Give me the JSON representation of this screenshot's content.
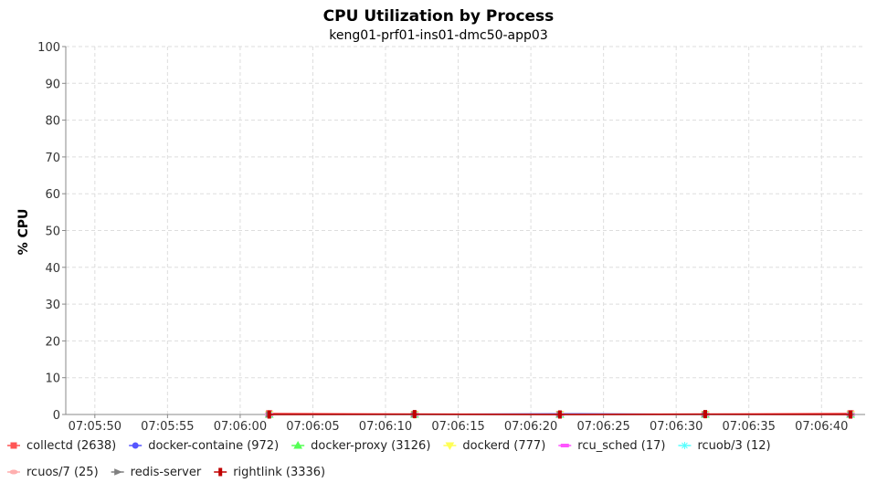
{
  "chart_data": {
    "type": "line",
    "title": "CPU Utilization by Process",
    "subtitle": "keng01-prf01-ins01-dmc50-app03",
    "xlabel": "",
    "ylabel": "% CPU",
    "ylim": [
      0,
      100
    ],
    "y_ticks": [
      0,
      10,
      20,
      30,
      40,
      50,
      60,
      70,
      80,
      90,
      100
    ],
    "x_range": [
      "07:05:48",
      "07:06:43"
    ],
    "x_ticks": [
      "07:05:50",
      "07:05:55",
      "07:06:00",
      "07:06:05",
      "07:06:10",
      "07:06:15",
      "07:06:20",
      "07:06:25",
      "07:06:30",
      "07:06:35",
      "07:06:40"
    ],
    "grid": true,
    "legend_position": "bottom",
    "x": [
      "07:06:02",
      "07:06:12",
      "07:06:22",
      "07:06:32",
      "07:06:42"
    ],
    "series": [
      {
        "name": "collectd (2638)",
        "color": "#ff5555",
        "marker": "square",
        "values": [
          0.3,
          0.1,
          0.1,
          0.1,
          0.3
        ]
      },
      {
        "name": "docker-containe (972)",
        "color": "#5555ff",
        "marker": "circle",
        "values": [
          0.0,
          0.0,
          0.2,
          0.0,
          0.0
        ]
      },
      {
        "name": "docker-proxy (3126)",
        "color": "#55ff55",
        "marker": "triangle-up",
        "values": [
          0,
          0,
          0,
          0,
          0
        ]
      },
      {
        "name": "dockerd (777)",
        "color": "#ffff55",
        "marker": "triangle-down",
        "values": [
          0,
          0,
          0,
          0,
          0
        ]
      },
      {
        "name": "rcu_sched (17)",
        "color": "#ff55ff",
        "marker": "hbar",
        "values": [
          0,
          0,
          0,
          0,
          0
        ]
      },
      {
        "name": "rcuob/3 (12)",
        "color": "#55ffff",
        "marker": "star",
        "values": [
          0,
          0,
          0,
          0,
          0
        ]
      },
      {
        "name": "rcuos/7 (25)",
        "color": "#ffafaf",
        "marker": "ellipse",
        "values": [
          0,
          0,
          0,
          0,
          0
        ]
      },
      {
        "name": "redis-server",
        "color": "#808080",
        "marker": "arrow-right",
        "values": [
          0,
          0,
          0,
          0,
          0
        ]
      },
      {
        "name": "rightlink (3336)",
        "color": "#c00000",
        "marker": "vbar",
        "values": [
          0.0,
          0.1,
          0.0,
          0.1,
          0.0
        ]
      }
    ]
  }
}
